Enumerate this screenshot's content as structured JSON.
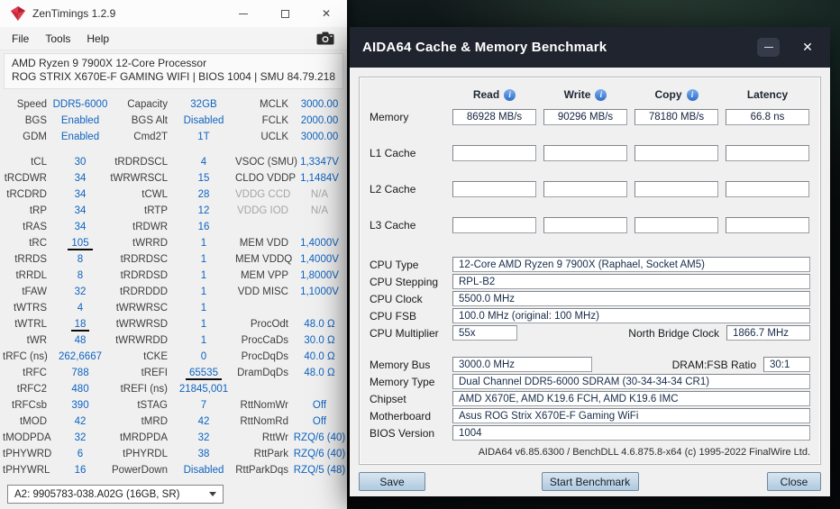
{
  "colors": {
    "zt_value_blue": "#0e63c0",
    "zt_muted_gray": "#a5a5a5",
    "aida_titlebar_bg": "#20242e",
    "aida_button_face": "#bcd2e4",
    "info_icon_blue": "#2f6cc8",
    "annotation_underline": "#0a0a0a"
  },
  "zentimings": {
    "window_title": "ZenTimings 1.2.9",
    "window_controls": {
      "minimize": "minimize",
      "maximize": "maximize",
      "close": "✕"
    },
    "menu_items": [
      "File",
      "Tools",
      "Help"
    ],
    "screenshot_icon": "camera-icon",
    "processor": "AMD Ryzen 9 7900X 12-Core Processor",
    "board_info": "ROG STRIX X670E-F GAMING WIFI | BIOS 1004 | SMU 84.79.218",
    "memory_rows": [
      [
        {
          "label": "Speed",
          "value": "DDR5-6000"
        },
        {
          "label": "Capacity",
          "value": "32GB"
        },
        {
          "label": "MCLK",
          "value": "3000.00"
        }
      ],
      [
        {
          "label": "BGS",
          "value": "Enabled"
        },
        {
          "label": "BGS Alt",
          "value": "Disabled"
        },
        {
          "label": "FCLK",
          "value": "2000.00"
        }
      ],
      [
        {
          "label": "GDM",
          "value": "Enabled"
        },
        {
          "label": "Cmd2T",
          "value": "1T"
        },
        {
          "label": "UCLK",
          "value": "3000.00"
        }
      ]
    ],
    "timing_rows": [
      [
        {
          "label": "tCL",
          "value": "30"
        },
        {
          "label": "tRDRDSCL",
          "value": "4"
        },
        {
          "label": "VSOC (SMU)",
          "value": "1,3347V"
        }
      ],
      [
        {
          "label": "tRCDWR",
          "value": "34"
        },
        {
          "label": "tWRWRSCL",
          "value": "15"
        },
        {
          "label": "CLDO VDDP",
          "value": "1,1484V"
        }
      ],
      [
        {
          "label": "tRCDRD",
          "value": "34"
        },
        {
          "label": "tCWL",
          "value": "28"
        },
        {
          "label": "VDDG CCD",
          "value": "N/A",
          "muted": true
        }
      ],
      [
        {
          "label": "tRP",
          "value": "34"
        },
        {
          "label": "tRTP",
          "value": "12"
        },
        {
          "label": "VDDG IOD",
          "value": "N/A",
          "muted": true
        }
      ],
      [
        {
          "label": "tRAS",
          "value": "34"
        },
        {
          "label": "tRDWR",
          "value": "16"
        },
        null
      ],
      [
        {
          "label": "tRC",
          "value": "105",
          "underline": true
        },
        {
          "label": "tWRRD",
          "value": "1"
        },
        {
          "label": "MEM VDD",
          "value": "1,4000V"
        }
      ],
      [
        {
          "label": "tRRDS",
          "value": "8"
        },
        {
          "label": "tRDRDSC",
          "value": "1"
        },
        {
          "label": "MEM VDDQ",
          "value": "1,4000V"
        }
      ],
      [
        {
          "label": "tRRDL",
          "value": "8"
        },
        {
          "label": "tRDRDSD",
          "value": "1"
        },
        {
          "label": "MEM VPP",
          "value": "1,8000V"
        }
      ],
      [
        {
          "label": "tFAW",
          "value": "32"
        },
        {
          "label": "tRDRDDD",
          "value": "1"
        },
        {
          "label": "VDD MISC",
          "value": "1,1000V"
        }
      ],
      [
        {
          "label": "tWTRS",
          "value": "4"
        },
        {
          "label": "tWRWRSC",
          "value": "1"
        },
        null
      ],
      [
        {
          "label": "tWTRL",
          "value": "18",
          "underline": true
        },
        {
          "label": "tWRWRSD",
          "value": "1"
        },
        {
          "label": "ProcOdt",
          "value": "48.0 Ω"
        }
      ],
      [
        {
          "label": "tWR",
          "value": "48"
        },
        {
          "label": "tWRWRDD",
          "value": "1"
        },
        {
          "label": "ProcCaDs",
          "value": "30.0 Ω"
        }
      ],
      [
        {
          "label": "tRFC (ns)",
          "value": "262,6667"
        },
        {
          "label": "tCKE",
          "value": "0"
        },
        {
          "label": "ProcDqDs",
          "value": "40.0 Ω"
        }
      ],
      [
        {
          "label": "tRFC",
          "value": "788"
        },
        {
          "label": "tREFI",
          "value": "65535",
          "underline": true
        },
        {
          "label": "DramDqDs",
          "value": "48.0 Ω"
        }
      ],
      [
        {
          "label": "tRFC2",
          "value": "480"
        },
        {
          "label": "tREFI (ns)",
          "value": "21845,001"
        },
        null
      ],
      [
        {
          "label": "tRFCsb",
          "value": "390"
        },
        {
          "label": "tSTAG",
          "value": "7"
        },
        {
          "label": "RttNomWr",
          "value": "Off"
        }
      ],
      [
        {
          "label": "tMOD",
          "value": "42"
        },
        {
          "label": "tMRD",
          "value": "42"
        },
        {
          "label": "RttNomRd",
          "value": "Off"
        }
      ],
      [
        {
          "label": "tMODPDA",
          "value": "32"
        },
        {
          "label": "tMRDPDA",
          "value": "32"
        },
        {
          "label": "RttWr",
          "value": "RZQ/6 (40)"
        }
      ],
      [
        {
          "label": "tPHYWRD",
          "value": "6"
        },
        {
          "label": "tPHYRDL",
          "value": "38"
        },
        {
          "label": "RttPark",
          "value": "RZQ/6 (40)"
        }
      ],
      [
        {
          "label": "tPHYWRL",
          "value": "16"
        },
        {
          "label": "PowerDown",
          "value": "Disabled"
        },
        {
          "label": "RttParkDqs",
          "value": "RZQ/5 (48)"
        }
      ]
    ],
    "dimm_selector": "A2: 9905783-038.A02G (16GB, SR)"
  },
  "aida64": {
    "window_title": "AIDA64 Cache & Memory Benchmark",
    "window_controls": {
      "minimize": "minimize",
      "close": "✕"
    },
    "columns": [
      "Read",
      "Write",
      "Copy",
      "Latency"
    ],
    "bench_rows": [
      {
        "label": "Memory",
        "values": [
          "86928 MB/s",
          "90296 MB/s",
          "78180 MB/s",
          "66.8 ns"
        ]
      },
      {
        "label": "L1 Cache",
        "values": [
          "",
          "",
          "",
          ""
        ]
      },
      {
        "label": "L2 Cache",
        "values": [
          "",
          "",
          "",
          ""
        ]
      },
      {
        "label": "L3 Cache",
        "values": [
          "",
          "",
          "",
          ""
        ]
      }
    ],
    "info_rows": [
      {
        "label": "CPU Type",
        "value": "12-Core AMD Ryzen 9 7900X  (Raphael, Socket AM5)"
      },
      {
        "label": "CPU Stepping",
        "value": "RPL-B2"
      },
      {
        "label": "CPU Clock",
        "value": "5500.0 MHz"
      },
      {
        "label": "CPU FSB",
        "value": "100.0 MHz  (original: 100 MHz)"
      },
      {
        "label": "CPU Multiplier",
        "value": "55x",
        "box": "xs",
        "right_label": "North Bridge Clock",
        "right_value": "1866.7 MHz",
        "right_box": "md",
        "gap_after": true
      },
      {
        "label": "Memory Bus",
        "value": "3000.0 MHz",
        "box": "sm",
        "right_label": "DRAM:FSB Ratio",
        "right_value": "30:1",
        "right_box": "xxs"
      },
      {
        "label": "Memory Type",
        "value": "Dual Channel DDR5-6000 SDRAM  (30-34-34-34 CR1)"
      },
      {
        "label": "Chipset",
        "value": "AMD X670E, AMD K19.6 FCH, AMD K19.6 IMC"
      },
      {
        "label": "Motherboard",
        "value": "Asus ROG Strix X670E-F Gaming WiFi"
      },
      {
        "label": "BIOS Version",
        "value": "1004"
      }
    ],
    "footer": "AIDA64 v6.85.6300 / BenchDLL 4.6.875.8-x64  (c) 1995-2022 FinalWire Ltd.",
    "buttons": [
      {
        "id": "save",
        "label": "Save"
      },
      {
        "id": "start",
        "label": "Start Benchmark"
      },
      {
        "id": "close",
        "label": "Close"
      }
    ]
  }
}
